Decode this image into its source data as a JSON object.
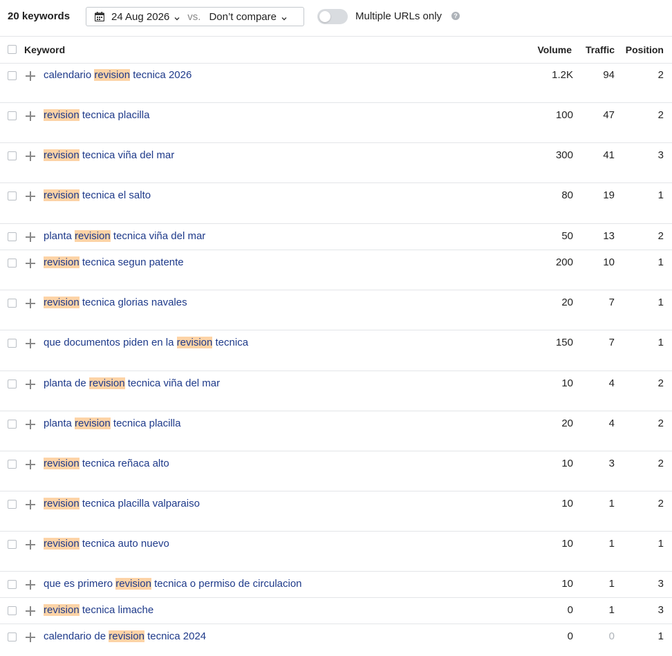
{
  "toolbar": {
    "keyword_count": "20 keywords",
    "date": "24 Aug 2026",
    "vs": "vs.",
    "compare": "Don’t compare",
    "toggle_label": "Multiple URLs only",
    "help": "?"
  },
  "table": {
    "headers": {
      "keyword": "Keyword",
      "volume": "Volume",
      "traffic": "Traffic",
      "position": "Position"
    },
    "rows": [
      {
        "pre": "calendario ",
        "hl": "revision",
        "post": " tecnica 2026",
        "volume": "1.2K",
        "traffic": "94",
        "position": "2"
      },
      {
        "pre": "",
        "hl": "revision",
        "post": " tecnica placilla",
        "volume": "100",
        "traffic": "47",
        "position": "2"
      },
      {
        "pre": "",
        "hl": "revision",
        "post": " tecnica viña del mar",
        "volume": "300",
        "traffic": "41",
        "position": "3"
      },
      {
        "pre": "",
        "hl": "revision",
        "post": " tecnica el salto",
        "volume": "80",
        "traffic": "19",
        "position": "1"
      },
      {
        "pre": "planta ",
        "hl": "revision",
        "post": " tecnica viña del mar",
        "volume": "50",
        "traffic": "13",
        "position": "2"
      },
      {
        "pre": "",
        "hl": "revision",
        "post": " tecnica segun patente",
        "volume": "200",
        "traffic": "10",
        "position": "1"
      },
      {
        "pre": "",
        "hl": "revision",
        "post": " tecnica glorias navales",
        "volume": "20",
        "traffic": "7",
        "position": "1"
      },
      {
        "pre": "que documentos piden en la ",
        "hl": "revision",
        "post": " tecnica",
        "volume": "150",
        "traffic": "7",
        "position": "1"
      },
      {
        "pre": "planta de ",
        "hl": "revision",
        "post": " tecnica viña del mar",
        "volume": "10",
        "traffic": "4",
        "position": "2"
      },
      {
        "pre": "planta ",
        "hl": "revision",
        "post": " tecnica placilla",
        "volume": "20",
        "traffic": "4",
        "position": "2"
      },
      {
        "pre": "",
        "hl": "revision",
        "post": " tecnica reñaca alto",
        "volume": "10",
        "traffic": "3",
        "position": "2"
      },
      {
        "pre": "",
        "hl": "revision",
        "post": " tecnica placilla valparaiso",
        "volume": "10",
        "traffic": "1",
        "position": "2"
      },
      {
        "pre": "",
        "hl": "revision",
        "post": " tecnica auto nuevo",
        "volume": "10",
        "traffic": "1",
        "position": "1"
      },
      {
        "pre": "que es primero ",
        "hl": "revision",
        "post": " tecnica o permiso de circulacion",
        "volume": "10",
        "traffic": "1",
        "position": "3"
      },
      {
        "pre": "",
        "hl": "revision",
        "post": " tecnica limache",
        "volume": "0",
        "traffic": "1",
        "position": "3"
      },
      {
        "pre": "calendario de ",
        "hl": "revision",
        "post": " tecnica 2024",
        "volume": "0",
        "traffic": "0",
        "position": "1"
      }
    ]
  }
}
